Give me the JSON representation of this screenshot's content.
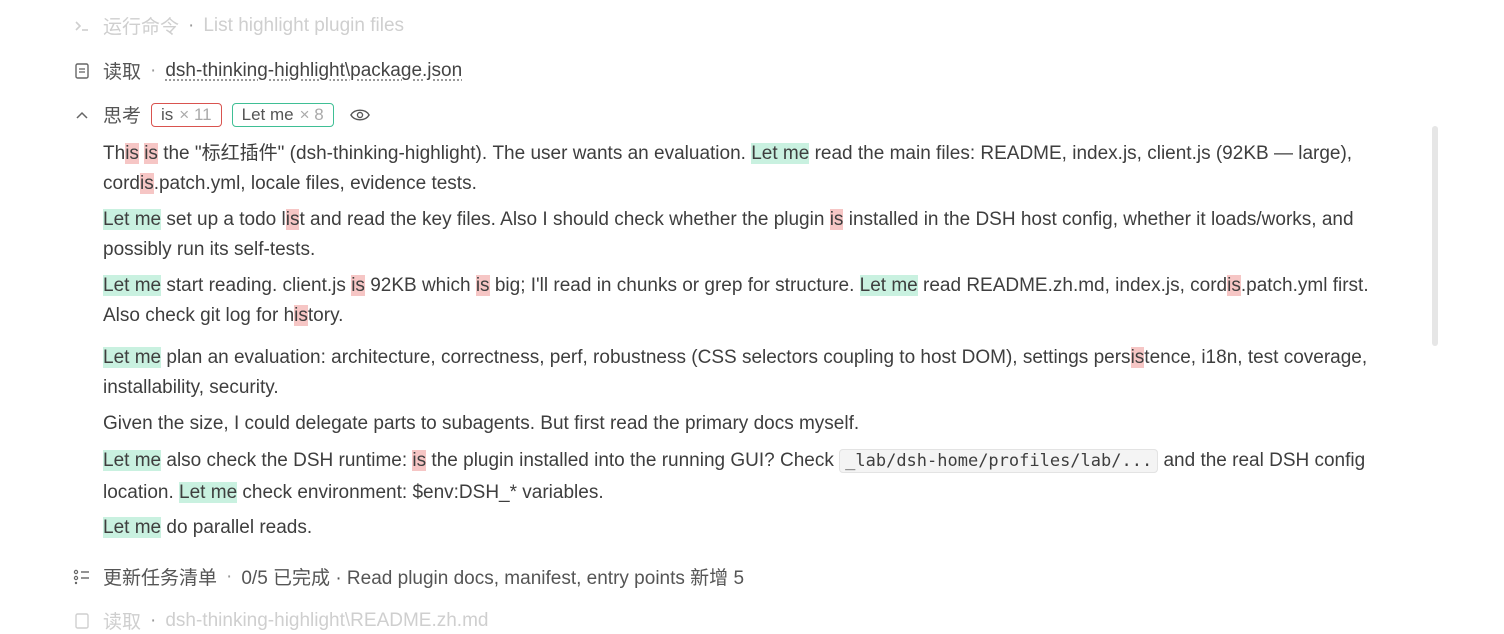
{
  "steps": {
    "run": {
      "label": "运行命令",
      "detail": "List highlight plugin files"
    },
    "read": {
      "label": "读取",
      "path": "dsh-thinking-highlight\\package.json"
    },
    "think": {
      "label": "思考",
      "chips": [
        {
          "text": "is",
          "count": "× 11"
        },
        {
          "text": "Let me",
          "count": "× 8"
        }
      ]
    },
    "todo": {
      "label": "更新任务清单",
      "detail": "0/5 已完成 · Read plugin docs, manifest, entry points 新增 5"
    },
    "cut_off": {
      "label": "读取",
      "detail": "dsh-thinking-highlight\\README.zh.md"
    }
  },
  "icons": {
    "run": "terminal-icon",
    "read": "file-icon",
    "think": "chevron-up-icon",
    "eye": "eye-icon",
    "todo": "list-icon"
  },
  "colors": {
    "highlight_is": "#f6c6c5",
    "highlight_letme": "#c9f1e0",
    "chip_red": "#d9534f",
    "chip_green": "#3fbf95"
  },
  "paragraphs": [
    [
      {
        "t": "Th"
      },
      {
        "t": "is",
        "h": "r"
      },
      {
        "t": " "
      },
      {
        "t": "is",
        "h": "r"
      },
      {
        "t": " the \"标红插件\" (dsh-thinking-highlight). The user wants an evaluation. "
      },
      {
        "t": "Let me",
        "h": "g"
      },
      {
        "t": " read the main files: README, index.js, client.js (92KB — large), cord"
      },
      {
        "t": "is",
        "h": "r"
      },
      {
        "t": ".patch.yml, locale files, evidence tests."
      }
    ],
    [
      {
        "t": "Let me",
        "h": "g"
      },
      {
        "t": " set up a todo l"
      },
      {
        "t": "is",
        "h": "r"
      },
      {
        "t": "t and read the key files. Also I should check whether the plugin "
      },
      {
        "t": "is",
        "h": "r"
      },
      {
        "t": " installed in the DSH host config, whether it loads/works, and possibly run its self-tests."
      }
    ],
    [
      {
        "t": "Let me",
        "h": "g"
      },
      {
        "t": " start reading. client.js "
      },
      {
        "t": "is",
        "h": "r"
      },
      {
        "t": " 92KB which "
      },
      {
        "t": "is",
        "h": "r"
      },
      {
        "t": " big; I'll read in chunks or grep for structure. "
      },
      {
        "t": "Let me",
        "h": "g"
      },
      {
        "t": " read README.zh.md, index.js, cord"
      },
      {
        "t": "is",
        "h": "r"
      },
      {
        "t": ".patch.yml first. Also check git log for h"
      },
      {
        "t": "is",
        "h": "r"
      },
      {
        "t": "tory."
      }
    ],
    [
      {
        "t": "Let me",
        "h": "g"
      },
      {
        "t": " plan an evaluation: architecture, correctness, perf, robustness (CSS selectors coupling to host DOM), settings pers"
      },
      {
        "t": "is",
        "h": "r"
      },
      {
        "t": "tence, i18n, test coverage, installability, security."
      }
    ],
    [
      {
        "t": "Given the size, I could delegate parts to subagents. But first read the primary docs myself."
      }
    ],
    [
      {
        "t": "Let me",
        "h": "g"
      },
      {
        "t": " also check the DSH runtime: "
      },
      {
        "t": "is",
        "h": "r"
      },
      {
        "t": " the plugin installed into the running GUI? Check "
      },
      {
        "t": "_lab/dsh-home/profiles/lab/...",
        "code": true
      },
      {
        "t": " and the real DSH config location. "
      },
      {
        "t": "Let me",
        "h": "g"
      },
      {
        "t": " check environment: $env:DSH_* variables."
      }
    ],
    [
      {
        "t": "Let me",
        "h": "g"
      },
      {
        "t": " do parallel reads."
      }
    ]
  ]
}
